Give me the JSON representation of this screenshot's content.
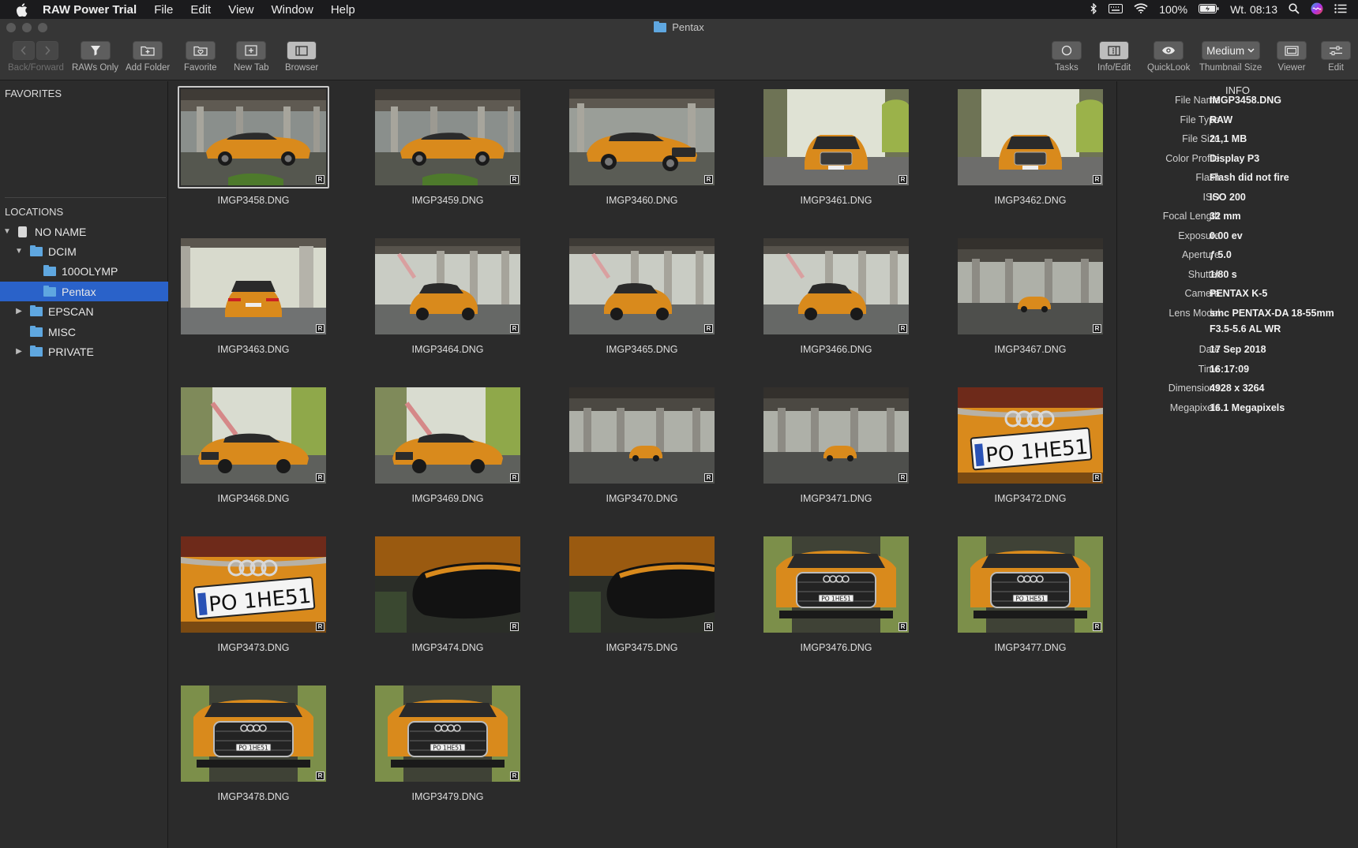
{
  "menubar": {
    "app_name": "RAW Power Trial",
    "menus": [
      "File",
      "Edit",
      "View",
      "Window",
      "Help"
    ],
    "battery": "100%",
    "clock": "Wt. 08:13"
  },
  "window": {
    "title": "Pentax"
  },
  "toolbar": {
    "back_forward": "Back/Forward",
    "raws_only": "RAWs Only",
    "add_folder": "Add Folder",
    "favorite": "Favorite",
    "new_tab": "New Tab",
    "browser": "Browser",
    "tasks": "Tasks",
    "info_edit": "Info/Edit",
    "quicklook": "QuickLook",
    "thumbnail_size_label": "Thumbnail Size",
    "thumbnail_size_value": "Medium",
    "viewer": "Viewer",
    "edit": "Edit"
  },
  "sidebar": {
    "favorites_header": "FAVORITES",
    "locations_header": "LOCATIONS",
    "items": [
      {
        "label": "NO NAME",
        "level": 0,
        "expanded": true,
        "type": "drive"
      },
      {
        "label": "DCIM",
        "level": 1,
        "expanded": true,
        "type": "folder"
      },
      {
        "label": "100OLYMP",
        "level": 2,
        "type": "folder"
      },
      {
        "label": "Pentax",
        "level": 2,
        "type": "folder",
        "selected": true
      },
      {
        "label": "EPSCAN",
        "level": 1,
        "expanded": false,
        "type": "folder"
      },
      {
        "label": "MISC",
        "level": 1,
        "type": "folder"
      },
      {
        "label": "PRIVATE",
        "level": 1,
        "expanded": false,
        "type": "folder"
      }
    ]
  },
  "grid": {
    "badge": "R",
    "items": [
      {
        "name": "IMGP3458.DNG",
        "scene": "side-under",
        "selected": true
      },
      {
        "name": "IMGP3459.DNG",
        "scene": "side-under"
      },
      {
        "name": "IMGP3460.DNG",
        "scene": "front34-under"
      },
      {
        "name": "IMGP3461.DNG",
        "scene": "front-road"
      },
      {
        "name": "IMGP3462.DNG",
        "scene": "front-road"
      },
      {
        "name": "IMGP3463.DNG",
        "scene": "rear-road"
      },
      {
        "name": "IMGP3464.DNG",
        "scene": "rear34-under"
      },
      {
        "name": "IMGP3465.DNG",
        "scene": "rear34-under"
      },
      {
        "name": "IMGP3466.DNG",
        "scene": "rear34-under"
      },
      {
        "name": "IMGP3467.DNG",
        "scene": "far-under"
      },
      {
        "name": "IMGP3468.DNG",
        "scene": "front34-trees"
      },
      {
        "name": "IMGP3469.DNG",
        "scene": "front34-trees"
      },
      {
        "name": "IMGP3470.DNG",
        "scene": "far-under"
      },
      {
        "name": "IMGP3471.DNG",
        "scene": "far-under"
      },
      {
        "name": "IMGP3472.DNG",
        "scene": "plate"
      },
      {
        "name": "IMGP3473.DNG",
        "scene": "plate"
      },
      {
        "name": "IMGP3474.DNG",
        "scene": "mirror"
      },
      {
        "name": "IMGP3475.DNG",
        "scene": "mirror"
      },
      {
        "name": "IMGP3476.DNG",
        "scene": "grille"
      },
      {
        "name": "IMGP3477.DNG",
        "scene": "grille"
      },
      {
        "name": "IMGP3478.DNG",
        "scene": "grille"
      },
      {
        "name": "IMGP3479.DNG",
        "scene": "grille"
      }
    ]
  },
  "plate_text": "PO 1HE51",
  "info": {
    "title": "INFO",
    "rows": [
      {
        "key": "File Name",
        "value": "IMGP3458.DNG"
      },
      {
        "key": "File Type",
        "value": "RAW"
      },
      {
        "key": "File Size",
        "value": "21,1 MB"
      },
      {
        "key": "Color Profile",
        "value": "Display P3"
      },
      {
        "key": "Flash",
        "value": "Flash did not fire"
      },
      {
        "key": "ISO",
        "value": "ISO 200"
      },
      {
        "key": "Focal Length",
        "value": "32 mm"
      },
      {
        "key": "Exposure",
        "value": "0.00 ev"
      },
      {
        "key": "Aperture",
        "value": "ƒ 5.0"
      },
      {
        "key": "Shutter",
        "value": "1/80 s"
      },
      {
        "key": "Camera",
        "value": "PENTAX K-5"
      },
      {
        "key": "Lens Model",
        "value": "smc PENTAX-DA 18-55mm F3.5-5.6 AL WR"
      },
      {
        "key": "Date",
        "value": "17 Sep 2018"
      },
      {
        "key": "Time",
        "value": "16:17:09"
      },
      {
        "key": "Dimensions",
        "value": "4928 x 3264"
      },
      {
        "key": "Megapixels",
        "value": "16.1 Megapixels"
      }
    ]
  },
  "colors": {
    "accent": "#2a62c9",
    "folder": "#5fa7e0",
    "car": "#d98a1c"
  }
}
